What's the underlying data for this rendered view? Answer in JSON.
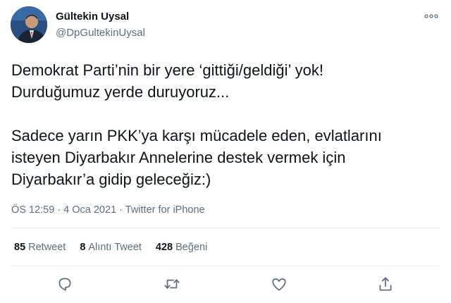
{
  "user": {
    "name": "Gültekin Uysal",
    "handle": "@DpGultekinUysal",
    "avatar_icon": "profile-photo"
  },
  "tweet": {
    "text": "Demokrat Parti’nin bir yere ‘gittiği/geldiği’ yok!\nDurduğumuz yerde duruyoruz...\n\nSadece yarın PKK’ya karşı mücadele eden, evlatlarını\nisteyen Diyarbakır Annelerine destek vermek için\nDiyarbakır’a gidip geleceğiz:)"
  },
  "meta": {
    "time": "ÖS 12:59",
    "separator": " · ",
    "date": "4 Oca 2021",
    "source": "Twitter for iPhone"
  },
  "stats": {
    "retweets_count": "85",
    "retweets_label": "Retweet",
    "quotes_count": "8",
    "quotes_label": "Alıntı Tweet",
    "likes_count": "428",
    "likes_label": "Beğeni"
  },
  "actions": {
    "reply_icon": "reply-icon",
    "retweet_icon": "retweet-icon",
    "like_icon": "heart-icon",
    "share_icon": "share-icon"
  },
  "colors": {
    "text": "#0f1419",
    "secondary": "#5b7083",
    "divider": "#e6ecf0"
  }
}
